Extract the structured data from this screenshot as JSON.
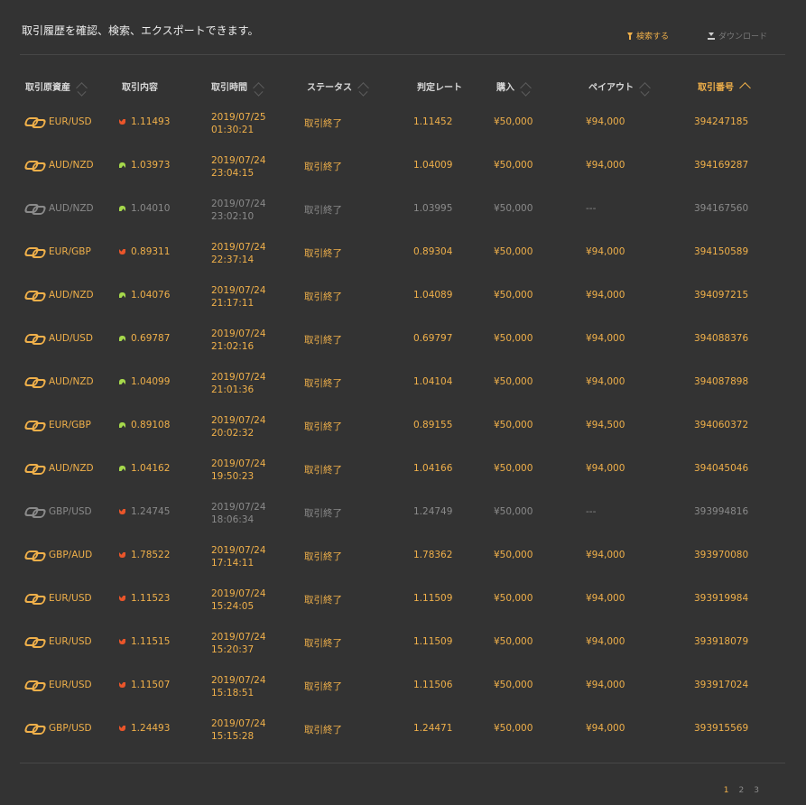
{
  "header": {
    "title": "取引履歴を確認、検索、エクスポートできます。",
    "search_label": "検索する",
    "download_label": "ダウンロード"
  },
  "columns": [
    "取引原資産",
    "取引内容",
    "取引時間",
    "ステータス",
    "判定レート",
    "購入",
    "ペイアウト",
    "取引番号"
  ],
  "rows": [
    {
      "asset": "EUR/USD",
      "direction": "down",
      "content": "1.11493",
      "date": "2019/07/25",
      "time": "01:30:21",
      "status": "取引終了",
      "rate": "1.11452",
      "buy": "¥50,000",
      "payout": "¥94,000",
      "id": "394247185",
      "active": true
    },
    {
      "asset": "AUD/NZD",
      "direction": "up",
      "content": "1.03973",
      "date": "2019/07/24",
      "time": "23:04:15",
      "status": "取引終了",
      "rate": "1.04009",
      "buy": "¥50,000",
      "payout": "¥94,000",
      "id": "394169287",
      "active": true
    },
    {
      "asset": "AUD/NZD",
      "direction": "up",
      "content": "1.04010",
      "date": "2019/07/24",
      "time": "23:02:10",
      "status": "取引終了",
      "rate": "1.03995",
      "buy": "¥50,000",
      "payout": "---",
      "id": "394167560",
      "active": false
    },
    {
      "asset": "EUR/GBP",
      "direction": "down",
      "content": "0.89311",
      "date": "2019/07/24",
      "time": "22:37:14",
      "status": "取引終了",
      "rate": "0.89304",
      "buy": "¥50,000",
      "payout": "¥94,000",
      "id": "394150589",
      "active": true
    },
    {
      "asset": "AUD/NZD",
      "direction": "up",
      "content": "1.04076",
      "date": "2019/07/24",
      "time": "21:17:11",
      "status": "取引終了",
      "rate": "1.04089",
      "buy": "¥50,000",
      "payout": "¥94,000",
      "id": "394097215",
      "active": true
    },
    {
      "asset": "AUD/USD",
      "direction": "up",
      "content": "0.69787",
      "date": "2019/07/24",
      "time": "21:02:16",
      "status": "取引終了",
      "rate": "0.69797",
      "buy": "¥50,000",
      "payout": "¥94,000",
      "id": "394088376",
      "active": true
    },
    {
      "asset": "AUD/NZD",
      "direction": "up",
      "content": "1.04099",
      "date": "2019/07/24",
      "time": "21:01:36",
      "status": "取引終了",
      "rate": "1.04104",
      "buy": "¥50,000",
      "payout": "¥94,000",
      "id": "394087898",
      "active": true
    },
    {
      "asset": "EUR/GBP",
      "direction": "up",
      "content": "0.89108",
      "date": "2019/07/24",
      "time": "20:02:32",
      "status": "取引終了",
      "rate": "0.89155",
      "buy": "¥50,000",
      "payout": "¥94,500",
      "id": "394060372",
      "active": true
    },
    {
      "asset": "AUD/NZD",
      "direction": "up",
      "content": "1.04162",
      "date": "2019/07/24",
      "time": "19:50:23",
      "status": "取引終了",
      "rate": "1.04166",
      "buy": "¥50,000",
      "payout": "¥94,000",
      "id": "394045046",
      "active": true
    },
    {
      "asset": "GBP/USD",
      "direction": "down",
      "content": "1.24745",
      "date": "2019/07/24",
      "time": "18:06:34",
      "status": "取引終了",
      "rate": "1.24749",
      "buy": "¥50,000",
      "payout": "---",
      "id": "393994816",
      "active": false
    },
    {
      "asset": "GBP/AUD",
      "direction": "down",
      "content": "1.78522",
      "date": "2019/07/24",
      "time": "17:14:11",
      "status": "取引終了",
      "rate": "1.78362",
      "buy": "¥50,000",
      "payout": "¥94,000",
      "id": "393970080",
      "active": true
    },
    {
      "asset": "EUR/USD",
      "direction": "down",
      "content": "1.11523",
      "date": "2019/07/24",
      "time": "15:24:05",
      "status": "取引終了",
      "rate": "1.11509",
      "buy": "¥50,000",
      "payout": "¥94,000",
      "id": "393919984",
      "active": true
    },
    {
      "asset": "EUR/USD",
      "direction": "down",
      "content": "1.11515",
      "date": "2019/07/24",
      "time": "15:20:37",
      "status": "取引終了",
      "rate": "1.11509",
      "buy": "¥50,000",
      "payout": "¥94,000",
      "id": "393918079",
      "active": true
    },
    {
      "asset": "EUR/USD",
      "direction": "down",
      "content": "1.11507",
      "date": "2019/07/24",
      "time": "15:18:51",
      "status": "取引終了",
      "rate": "1.11506",
      "buy": "¥50,000",
      "payout": "¥94,000",
      "id": "393917024",
      "active": true
    },
    {
      "asset": "GBP/USD",
      "direction": "down",
      "content": "1.24493",
      "date": "2019/07/24",
      "time": "15:15:28",
      "status": "取引終了",
      "rate": "1.24471",
      "buy": "¥50,000",
      "payout": "¥94,000",
      "id": "393915569",
      "active": true
    }
  ],
  "pagination": {
    "pages": [
      "1",
      "2",
      "3"
    ],
    "current": "1"
  },
  "colors": {
    "accent": "#f0b04a",
    "muted": "#8a8a8a",
    "up": "#a6d94b",
    "down": "#e9552a",
    "background": "#333333"
  }
}
